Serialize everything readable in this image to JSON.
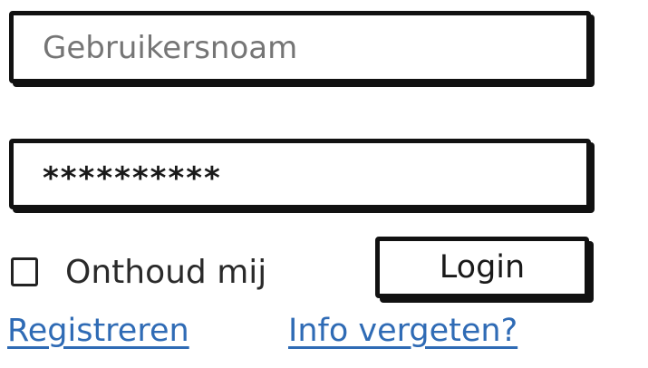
{
  "login_form": {
    "username": {
      "placeholder": "Gebruikersnoam",
      "value": ""
    },
    "password": {
      "value": "**********"
    },
    "remember_me": {
      "label": "Onthoud mij",
      "checked": false
    },
    "login_button_label": "Login",
    "links": {
      "register": "Registreren",
      "forgot_info": "Info vergeten?"
    }
  },
  "colors": {
    "link": "#2f6bb5",
    "border": "#111111"
  }
}
